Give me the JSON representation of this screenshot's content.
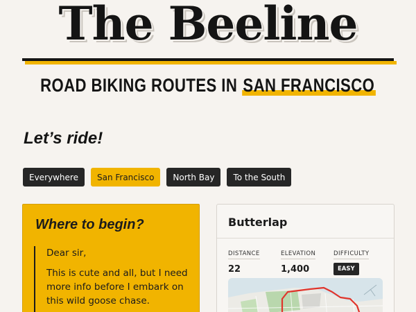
{
  "brand": {
    "title": "The Beeline"
  },
  "tagline": {
    "prefix": "ROAD BIKING ROUTES IN ",
    "highlight": "SAN FRANCISCO"
  },
  "greeting": "Let’s ride!",
  "filters": [
    {
      "label": "Everywhere",
      "active": false
    },
    {
      "label": "San Francisco",
      "active": true
    },
    {
      "label": "North Bay",
      "active": false
    },
    {
      "label": "To the South",
      "active": false
    }
  ],
  "intro_card": {
    "title": "Where to begin?",
    "salutation": "Dear sir,",
    "body": "This is cute and all, but I need more info before I embark on this wild goose chase."
  },
  "route_card": {
    "name": "Butterlap",
    "stats": {
      "distance_label": "DISTANCE",
      "distance": "22",
      "elevation_label": "ELEVATION",
      "elevation": "1,400",
      "difficulty_label": "DIFFICULTY",
      "difficulty": "EASY"
    }
  },
  "colors": {
    "accent": "#f1b400",
    "ink": "#1b1b1b",
    "background": "#f6f3ef",
    "route_line": "#e0342b"
  }
}
